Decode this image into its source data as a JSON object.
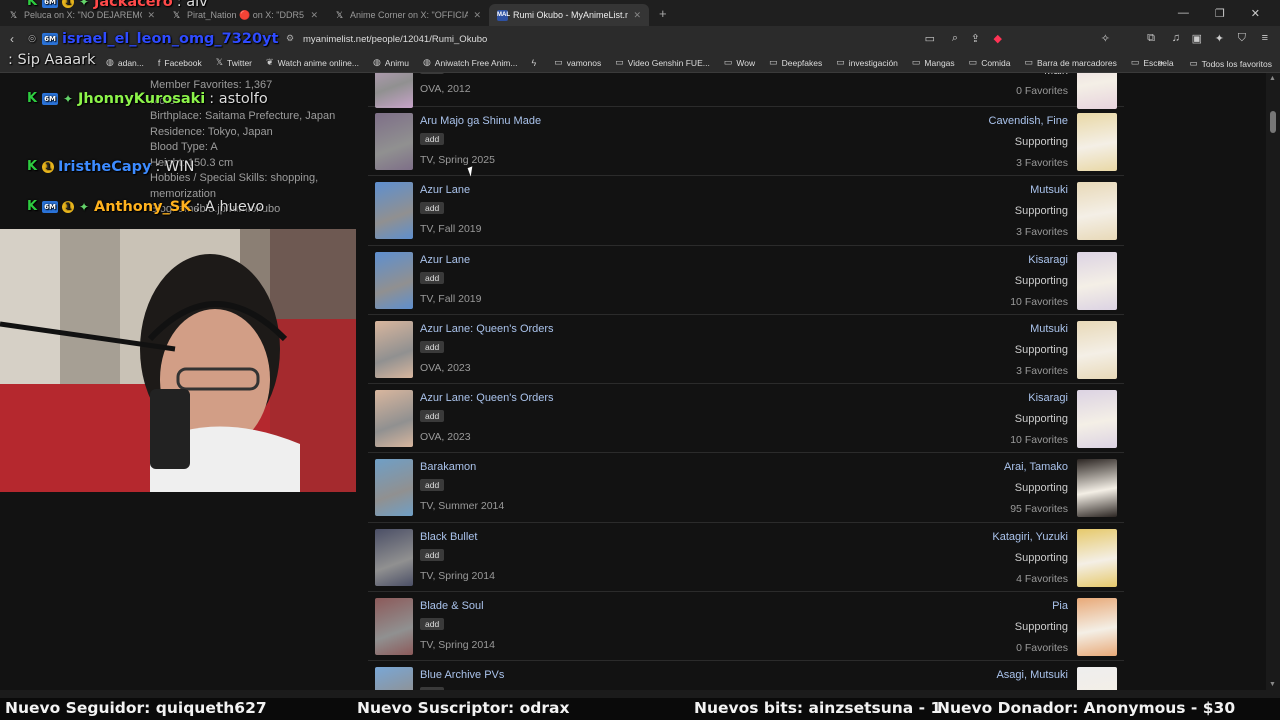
{
  "tabs": [
    {
      "label": "Peluca on X: \"NO DEJAREMOS QUE",
      "icon": "x-logo-icon",
      "active": false
    },
    {
      "label": "Pirat_Nation 🔴 on X: \"DDR5 RAM p",
      "icon": "x-logo-icon",
      "active": false
    },
    {
      "label": "Anime Corner on X: \"OFFICIAL: \"Mag",
      "icon": "x-logo-icon",
      "active": false
    },
    {
      "label": "Rumi Okubo - MyAnimeList.net",
      "icon": "mal-icon",
      "active": true
    }
  ],
  "new_tab": "+",
  "address": {
    "url": "myanimelist.net/people/12041/Rumi_Okubo"
  },
  "bookmarks": [
    {
      "label": "adan...",
      "icon": "globe-icon"
    },
    {
      "label": "Facebook",
      "icon": "facebook-icon"
    },
    {
      "label": "Twitter",
      "icon": "x-logo-icon"
    },
    {
      "label": "Watch anime online...",
      "icon": "leaf-icon"
    },
    {
      "label": "Animu",
      "icon": "globe-icon"
    },
    {
      "label": "Aniwatch Free Anim...",
      "icon": "globe-icon"
    },
    {
      "label": "",
      "icon": "bolt-icon"
    },
    {
      "label": "vamonos",
      "icon": "folder-icon"
    },
    {
      "label": "Video Genshin FUE...",
      "icon": "folder-icon"
    },
    {
      "label": "Wow",
      "icon": "folder-icon"
    },
    {
      "label": "Deepfakes",
      "icon": "folder-icon"
    },
    {
      "label": "investigación",
      "icon": "folder-icon"
    },
    {
      "label": "Mangas",
      "icon": "folder-icon"
    },
    {
      "label": "Comida",
      "icon": "folder-icon"
    },
    {
      "label": "Barra de marcadores",
      "icon": "folder-icon"
    },
    {
      "label": "Escuela",
      "icon": "folder-icon"
    }
  ],
  "bookmarks_end": "Todos los favoritos",
  "profile_info": [
    "Member Favorites: 1,367",
    "More:",
    "Birthplace: Saitama Prefecture, Japan",
    "Residence: Tokyo, Japan",
    "Blood Type: A",
    "Height: 150.3 cm",
    "Hobbies / Special Skills: shopping,",
    "memorization",
    "Blog: ameblo.jp/rumiokubo"
  ],
  "roles": [
    {
      "anime": "",
      "type": "OVA, 2012",
      "character": "",
      "role": "Main",
      "favorites": "0 Favorites",
      "thumb": "#c7a3c9",
      "cthumb": "#e7d3dd",
      "partial": true
    },
    {
      "anime": "Aru Majo ga Shinu Made",
      "type": "TV, Spring 2025",
      "character": "Cavendish, Fine",
      "role": "Supporting",
      "favorites": "3 Favorites",
      "thumb": "#7e6f88",
      "cthumb": "#e9d8a6"
    },
    {
      "anime": "Azur Lane",
      "type": "TV, Fall 2019",
      "character": "Mutsuki",
      "role": "Supporting",
      "favorites": "3 Favorites",
      "thumb": "#5e8fcf",
      "cthumb": "#e8d9b8"
    },
    {
      "anime": "Azur Lane",
      "type": "TV, Fall 2019",
      "character": "Kisaragi",
      "role": "Supporting",
      "favorites": "10 Favorites",
      "thumb": "#5e8fcf",
      "cthumb": "#dcd3e3"
    },
    {
      "anime": "Azur Lane: Queen's Orders",
      "type": "OVA, 2023",
      "character": "Mutsuki",
      "role": "Supporting",
      "favorites": "3 Favorites",
      "thumb": "#d8b69e",
      "cthumb": "#e8d9b8"
    },
    {
      "anime": "Azur Lane: Queen's Orders",
      "type": "OVA, 2023",
      "character": "Kisaragi",
      "role": "Supporting",
      "favorites": "10 Favorites",
      "thumb": "#d8b69e",
      "cthumb": "#dcd3e3"
    },
    {
      "anime": "Barakamon",
      "type": "TV, Summer 2014",
      "character": "Arai, Tamako",
      "role": "Supporting",
      "favorites": "95 Favorites",
      "thumb": "#6f9fc6",
      "cthumb": "#2b2522"
    },
    {
      "anime": "Black Bullet",
      "type": "TV, Spring 2014",
      "character": "Katagiri, Yuzuki",
      "role": "Supporting",
      "favorites": "4 Favorites",
      "thumb": "#4b4f66",
      "cthumb": "#e6c96b"
    },
    {
      "anime": "Blade & Soul",
      "type": "TV, Spring 2014",
      "character": "Pia",
      "role": "Supporting",
      "favorites": "0 Favorites",
      "thumb": "#8c5a5a",
      "cthumb": "#e8a978"
    },
    {
      "anime": "Blue Archive PVs",
      "type": "",
      "character": "Asagi, Mutsuki",
      "role": "",
      "favorites": "",
      "thumb": "#79a7d6",
      "cthumb": "#eeeeee"
    }
  ],
  "add_label": "add",
  "chat": [
    {
      "user": "Jackacero",
      "text": ": aiv",
      "color": "#ff4a4a",
      "badges": [
        "k",
        "sub",
        "bit",
        "star"
      ],
      "partial": true
    },
    {
      "user": "israel_el_leon_omg_7320yt",
      "text": "",
      "color": "#2f4bff",
      "badges": [
        "globe",
        "sub"
      ]
    },
    {
      "user": "",
      "text": ": Sip Aaaark",
      "color": "#ffffff",
      "badges": []
    },
    {
      "user": "JhonnyKurosaki",
      "text": ": astolfo",
      "color": "#8cf34a",
      "badges": [
        "k",
        "sub",
        "star"
      ]
    },
    {
      "user": "IristheCapy",
      "text": ": WIN",
      "color": "#3d8bff",
      "badges": [
        "k",
        "bit"
      ]
    },
    {
      "user": "Anthony_SK",
      "text": ": A huevo",
      "color": "#ffb21e",
      "badges": [
        "k",
        "sub",
        "bit",
        "star"
      ]
    }
  ],
  "ticker": {
    "follower": "Nuevo Seguidor: quiqueth627",
    "subscriber": "Nuevo Suscriptor: odrax",
    "bits": "Nuevos bits: ainzsetsuna - 1",
    "donor": "Nuevo Donador: Anonymous - $30"
  }
}
